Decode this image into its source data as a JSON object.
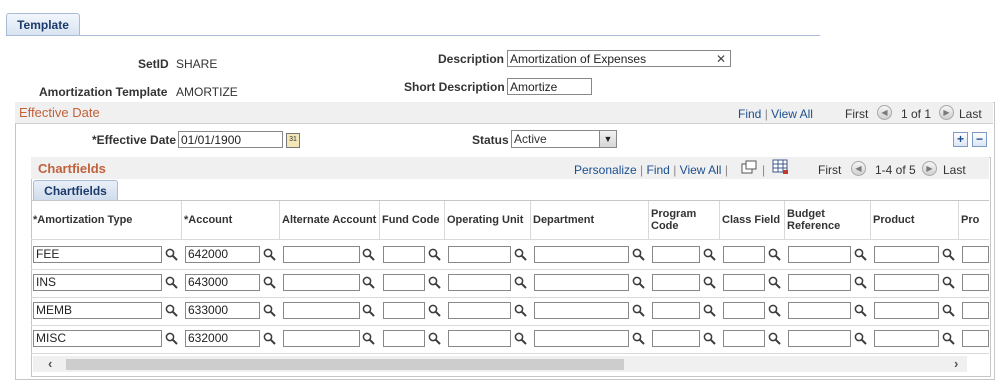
{
  "tab": "Template",
  "header": {
    "setid_label": "SetID",
    "setid_value": "SHARE",
    "template_label": "Amortization Template",
    "template_value": "AMORTIZE",
    "description_label": "Description",
    "description_value": "Amortization of Expenses",
    "short_description_label": "Short Description",
    "short_description_value": "Amortize"
  },
  "effective_date_section": {
    "title": "Effective Date",
    "find": "Find",
    "sep": "|",
    "view_all": "View All",
    "first": "First",
    "count": "1 of 1",
    "last": "Last",
    "effective_date_label": "*Effective Date",
    "effective_date_value": "01/01/1900",
    "status_label": "Status",
    "status_value": "Active"
  },
  "chartfields_grid": {
    "title": "Chartfields",
    "personalize": "Personalize",
    "find": "Find",
    "view_all": "View All",
    "sep": "|",
    "first": "First",
    "count": "1-4 of 5",
    "last": "Last",
    "tab": "Chartfields",
    "columns": [
      "*Amortization Type",
      "*Account",
      "Alternate Account",
      "Fund Code",
      "Operating Unit",
      "Department",
      "Program Code",
      "Class Field",
      "Budget Reference",
      "Product",
      "Pro"
    ],
    "rows": [
      {
        "type": "FEE",
        "account": "642000"
      },
      {
        "type": "INS",
        "account": "643000"
      },
      {
        "type": "MEMB",
        "account": "633000"
      },
      {
        "type": "MISC",
        "account": "632000"
      }
    ]
  }
}
